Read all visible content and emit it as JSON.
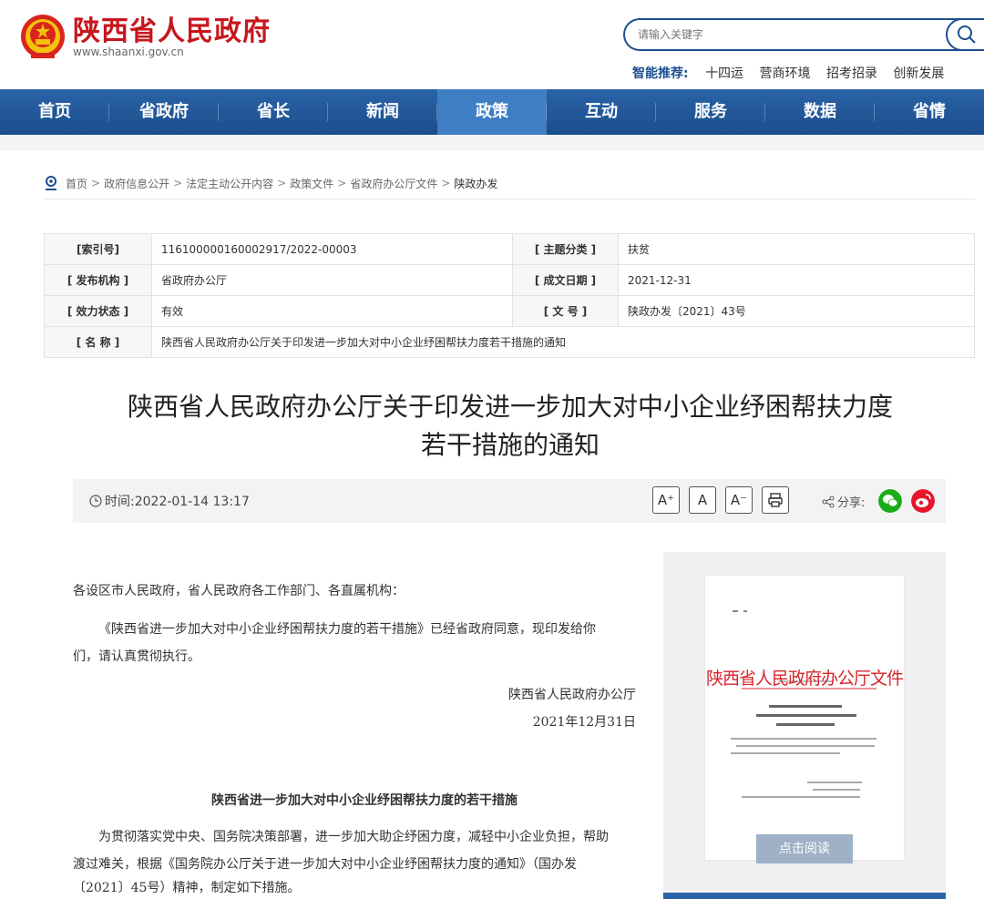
{
  "header": {
    "site_title": "陕西省人民政府",
    "site_url": "www.shaanxi.gov.cn",
    "search_placeholder": "请输入关键字",
    "recommend_label": "智能推荐:",
    "recommend_items": [
      "十四运",
      "营商环境",
      "招考招录",
      "创新发展"
    ]
  },
  "nav": {
    "items": [
      "首页",
      "省政府",
      "省长",
      "新闻",
      "政策",
      "互动",
      "服务",
      "数据",
      "省情"
    ],
    "active": "政策"
  },
  "breadcrumb": [
    "首页",
    "政府信息公开",
    "法定主动公开内容",
    "政策文件",
    "省政府办公厅文件",
    "陕政办发"
  ],
  "info": {
    "index_label": "[索引号]",
    "index_value": "116100000160002917/2022-00003",
    "topic_label": "[ 主题分类 ]",
    "topic_value": "扶贫",
    "issuer_label": "[ 发布机构 ]",
    "issuer_value": "省政府办公厅",
    "date_label": "[ 成文日期 ]",
    "date_value": "2021-12-31",
    "status_label": "[ 效力状态 ]",
    "status_value": "有效",
    "docno_label": "[ 文 号 ]",
    "docno_value": "陕政办发〔2021〕43号",
    "name_label": "[ 名 称 ]",
    "name_value": "陕西省人民政府办公厅关于印发进一步加大对中小企业纾困帮扶力度若干措施的通知"
  },
  "article": {
    "title_line1": "陕西省人民政府办公厅关于印发进一步加大对中小企业纾困帮扶力度",
    "title_line2": "若干措施的通知",
    "time": "时间:2022-01-14 13:17",
    "font_large": "A⁺",
    "font_mid": "A",
    "font_small": "A⁻",
    "share_label": "分享:",
    "salutation": "各设区市人民政府，省人民政府各工作部门、各直属机构：",
    "para1_line1": "《陕西省进一步加大对中小企业纾困帮扶力度的若干措施》已经省政府同意，现印发给你",
    "para1_line2": "们，请认真贯彻执行。",
    "signature": "陕西省人民政府办公厅",
    "sign_date": "2021年12月31日",
    "subtitle": "陕西省进一步加大对中小企业纾困帮扶力度的若干措施",
    "para2_line1": "为贯彻落实党中央、国务院决策部署，进一步加大助企纾困力度，减轻中小企业负担，帮助",
    "para2_line2": "渡过难关，根据《国务院办公厅关于进一步加大对中小企业纾困帮扶力度的通知》（国办发",
    "para2_line3": "〔2021〕45号）精神，制定如下措施。"
  },
  "side": {
    "doc_header": "陕西省人民政府办公厅文件",
    "read_button": "点击阅读"
  },
  "colors": {
    "brand_red": "#c8161d",
    "nav_blue": "#1b4e8d",
    "nav_active": "#3f7ec2",
    "wechat_green": "#1aad19",
    "weibo_red": "#e6162d"
  }
}
